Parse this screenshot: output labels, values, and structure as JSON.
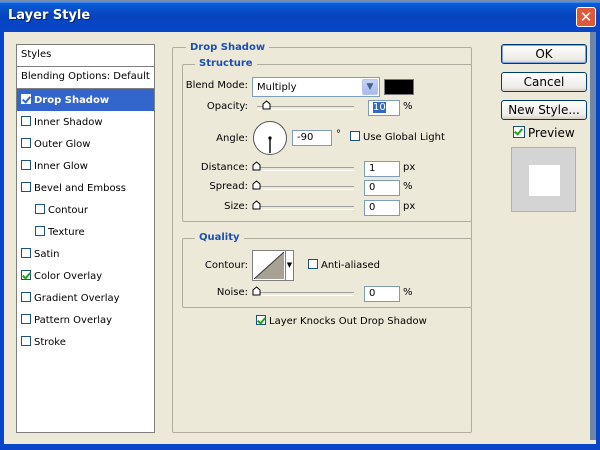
{
  "window": {
    "title": "Layer Style",
    "close_glyph": "✕"
  },
  "styles_panel": {
    "header": "Styles",
    "blending": "Blending Options: Default",
    "items": [
      {
        "label": "Drop Shadow",
        "checked": true,
        "selected": true
      },
      {
        "label": "Inner Shadow",
        "checked": false
      },
      {
        "label": "Outer Glow",
        "checked": false
      },
      {
        "label": "Inner Glow",
        "checked": false
      },
      {
        "label": "Bevel and Emboss",
        "checked": false
      },
      {
        "label": "Contour",
        "checked": false,
        "indent": true
      },
      {
        "label": "Texture",
        "checked": false,
        "indent": true
      },
      {
        "label": "Satin",
        "checked": false
      },
      {
        "label": "Color Overlay",
        "checked": true
      },
      {
        "label": "Gradient Overlay",
        "checked": false
      },
      {
        "label": "Pattern Overlay",
        "checked": false
      },
      {
        "label": "Stroke",
        "checked": false
      }
    ]
  },
  "drop_shadow": {
    "section_title": "Drop Shadow",
    "structure_title": "Structure",
    "blend_mode_label": "Blend Mode:",
    "blend_mode_value": "Multiply",
    "shadow_color": "#000000",
    "opacity_label": "Opacity:",
    "opacity_value": "10",
    "opacity_unit": "%",
    "angle_label": "Angle:",
    "angle_value": "-90",
    "angle_unit": "°",
    "global_light_label": "Use Global Light",
    "global_light_checked": false,
    "distance_label": "Distance:",
    "distance_value": "1",
    "distance_unit": "px",
    "spread_label": "Spread:",
    "spread_value": "0",
    "spread_unit": "%",
    "size_label": "Size:",
    "size_value": "0",
    "size_unit": "px",
    "quality_title": "Quality",
    "contour_label": "Contour:",
    "anti_aliased_label": "Anti-aliased",
    "anti_aliased_checked": false,
    "noise_label": "Noise:",
    "noise_value": "0",
    "noise_unit": "%",
    "knockout_label": "Layer Knocks Out Drop Shadow",
    "knockout_checked": true
  },
  "buttons": {
    "ok": "OK",
    "cancel": "Cancel",
    "new_style": "New Style..."
  },
  "preview": {
    "label": "Preview",
    "checked": true
  }
}
